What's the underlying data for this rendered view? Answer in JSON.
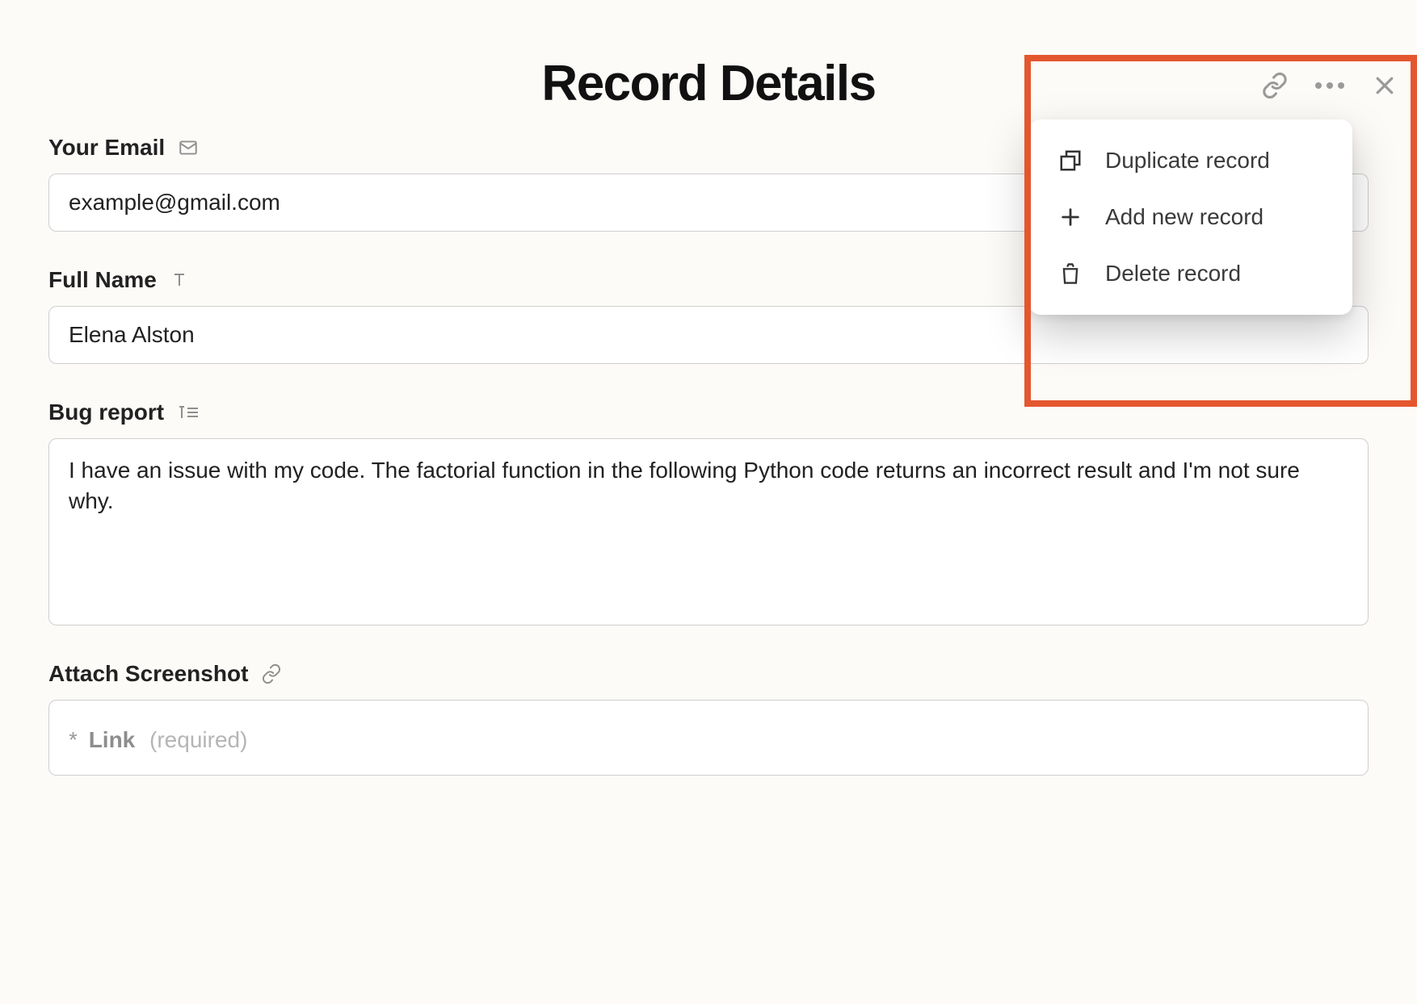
{
  "title": "Record Details",
  "fields": {
    "email": {
      "label": "Your Email",
      "value": "example@gmail.com"
    },
    "fullname": {
      "label": "Full Name",
      "value": "Elena Alston"
    },
    "bugreport": {
      "label": "Bug report",
      "value": "I have an issue with my code. The factorial function in the following Python code returns an incorrect result and I'm not sure why."
    },
    "attach": {
      "label": "Attach Screenshot",
      "placeholder_star": "*",
      "placeholder_link": "Link",
      "placeholder_req": "(required)"
    }
  },
  "menu": {
    "duplicate": "Duplicate record",
    "add": "Add new record",
    "delete": "Delete record"
  }
}
